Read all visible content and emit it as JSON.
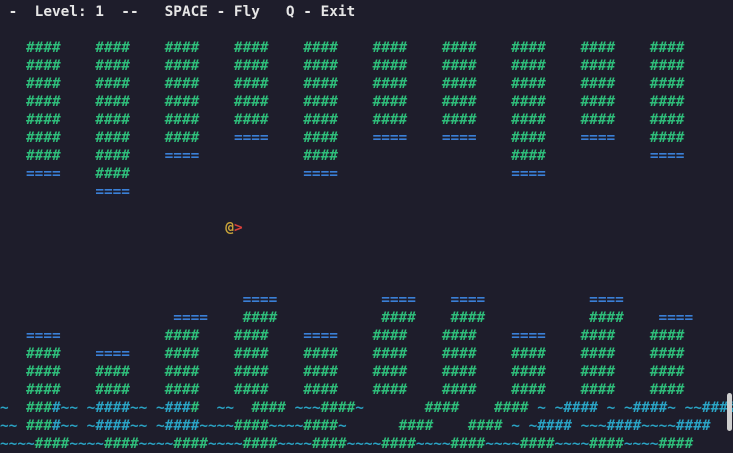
{
  "status_bar": {
    "text": " -  Level: 1  --   SPACE - Fly   Q - Exit"
  },
  "playfield": {
    "rows": [
      [
        [
          "",
          "text"
        ]
      ],
      [
        [
          "   ####    ####    ####    ####    ####    ####    ####    ####    ####    ####",
          "wall"
        ]
      ],
      [
        [
          "   ####    ####    ####    ####    ####    ####    ####    ####    ####    ####",
          "wall"
        ]
      ],
      [
        [
          "   ####    ####    ####    ####    ####    ####    ####    ####    ####    ####",
          "wall"
        ]
      ],
      [
        [
          "   ####    ####    ####    ####    ####    ####    ####    ####    ####    ####",
          "wall"
        ]
      ],
      [
        [
          "   ####    ####    ####    ####    ####    ####    ####    ####    ####    ####",
          "wall"
        ]
      ],
      [
        [
          "   ####    ####    ####    ",
          "wall"
        ],
        [
          "====",
          "cap"
        ],
        [
          "    ####    ",
          "wall"
        ],
        [
          "====    ====",
          "cap"
        ],
        [
          "    ####    ",
          "wall"
        ],
        [
          "====",
          "cap"
        ],
        [
          "    ####",
          "wall"
        ]
      ],
      [
        [
          "   ####    ####    ",
          "wall"
        ],
        [
          "====",
          "cap"
        ],
        [
          "            ####                    ####            ",
          "wall"
        ],
        [
          "====",
          "cap"
        ]
      ],
      [
        [
          "   ",
          "wall"
        ],
        [
          "====",
          "cap"
        ],
        [
          "    ####                    ",
          "wall"
        ],
        [
          "====",
          "cap"
        ],
        [
          "                    ",
          "wall"
        ],
        [
          "====",
          "cap"
        ]
      ],
      [
        [
          "           ",
          "wall"
        ],
        [
          "====",
          "cap"
        ]
      ],
      [
        [
          "",
          "text"
        ]
      ],
      [
        [
          "                          ",
          "text"
        ],
        [
          "@",
          "player"
        ],
        [
          ">",
          "nose"
        ]
      ],
      [
        [
          "",
          "text"
        ]
      ],
      [
        [
          "",
          "text"
        ]
      ],
      [
        [
          "",
          "text"
        ]
      ],
      [
        [
          "                            ",
          "text"
        ],
        [
          "====",
          "cap"
        ],
        [
          "            ",
          "text"
        ],
        [
          "====    ====",
          "cap"
        ],
        [
          "            ",
          "text"
        ],
        [
          "====",
          "cap"
        ]
      ],
      [
        [
          "                    ",
          "text"
        ],
        [
          "====",
          "cap"
        ],
        [
          "    ####            ####    ####            ####    ",
          "wall"
        ],
        [
          "====",
          "cap"
        ]
      ],
      [
        [
          "   ",
          "text"
        ],
        [
          "====",
          "cap"
        ],
        [
          "            ####    ####    ",
          "wall"
        ],
        [
          "====",
          "cap"
        ],
        [
          "    ####    ####    ",
          "wall"
        ],
        [
          "====",
          "cap"
        ],
        [
          "    ####    ####",
          "wall"
        ]
      ],
      [
        [
          "   ####    ",
          "wall"
        ],
        [
          "====",
          "cap"
        ],
        [
          "    ####    ####    ####    ####    ####    ####    ####    ####",
          "wall"
        ]
      ],
      [
        [
          "   ####    ####    ####    ####    ####    ####    ####    ####    ####    ####",
          "wall"
        ]
      ],
      [
        [
          "   ####    ####    ####    ####    ####    ####    ####    ####    ####    ####",
          "wall"
        ]
      ],
      [
        [
          "~",
          "water"
        ],
        [
          "  ",
          "text"
        ],
        [
          "###",
          "wall"
        ],
        [
          "#~~",
          "water"
        ],
        [
          " ",
          "text"
        ],
        [
          "~###",
          "water"
        ],
        [
          "#~~",
          "water"
        ],
        [
          " ",
          "text"
        ],
        [
          "~###",
          "water"
        ],
        [
          "#",
          "wall"
        ],
        [
          "  ",
          "text"
        ],
        [
          "~~",
          "water"
        ],
        [
          "  ",
          "text"
        ],
        [
          "####",
          "wall"
        ],
        [
          " ",
          "text"
        ],
        [
          "~~~",
          "water"
        ],
        [
          "####",
          "wall"
        ],
        [
          "~",
          "water"
        ],
        [
          "       ",
          "text"
        ],
        [
          "####",
          "wall"
        ],
        [
          "    ",
          "text"
        ],
        [
          "####",
          "wall"
        ],
        [
          " ",
          "text"
        ],
        [
          "~",
          "water"
        ],
        [
          " ",
          "text"
        ],
        [
          "~####",
          "water"
        ],
        [
          " ",
          "text"
        ],
        [
          "~",
          "water"
        ],
        [
          " ",
          "text"
        ],
        [
          "~####~",
          "water"
        ],
        [
          " ",
          "text"
        ],
        [
          "~~####",
          "water"
        ]
      ],
      [
        [
          "~~",
          "water"
        ],
        [
          " ",
          "text"
        ],
        [
          "###",
          "wall"
        ],
        [
          "#~~",
          "water"
        ],
        [
          " ",
          "text"
        ],
        [
          "~###",
          "water"
        ],
        [
          "#~~",
          "water"
        ],
        [
          " ",
          "text"
        ],
        [
          "~###",
          "water"
        ],
        [
          "#~~~~",
          "water"
        ],
        [
          "####",
          "wall"
        ],
        [
          "~~~~",
          "water"
        ],
        [
          "####",
          "wall"
        ],
        [
          "~",
          "water"
        ],
        [
          "      ",
          "text"
        ],
        [
          "####",
          "wall"
        ],
        [
          "    ",
          "text"
        ],
        [
          "####",
          "wall"
        ],
        [
          " ",
          "text"
        ],
        [
          "~",
          "water"
        ],
        [
          " ",
          "text"
        ],
        [
          "~####",
          "water"
        ],
        [
          " ",
          "text"
        ],
        [
          "~~~####~~~~####",
          "water"
        ]
      ],
      [
        [
          "~~~~",
          "water"
        ],
        [
          "####",
          "wall"
        ],
        [
          "~~~~",
          "water"
        ],
        [
          "####",
          "wall"
        ],
        [
          "~~~~",
          "water"
        ],
        [
          "####",
          "wall"
        ],
        [
          "~~~~",
          "water"
        ],
        [
          "####",
          "wall"
        ],
        [
          "~~~~",
          "water"
        ],
        [
          "####",
          "wall"
        ],
        [
          "~~~~",
          "water"
        ],
        [
          "####",
          "wall"
        ],
        [
          "~~~~",
          "water"
        ],
        [
          "####",
          "wall"
        ],
        [
          "~~~~",
          "water"
        ],
        [
          "####",
          "wall"
        ],
        [
          "~~~~",
          "water"
        ],
        [
          "####",
          "wall"
        ],
        [
          "~~~~",
          "water"
        ],
        [
          "####",
          "wall"
        ]
      ]
    ]
  },
  "colors": {
    "background": "#1e1d2b",
    "text": "#e6e6e6",
    "wall": "#2ebd7a",
    "cap": "#3a7fd6",
    "water": "#2aa3c4",
    "player": "#c9a43a",
    "nose": "#d8403a"
  }
}
